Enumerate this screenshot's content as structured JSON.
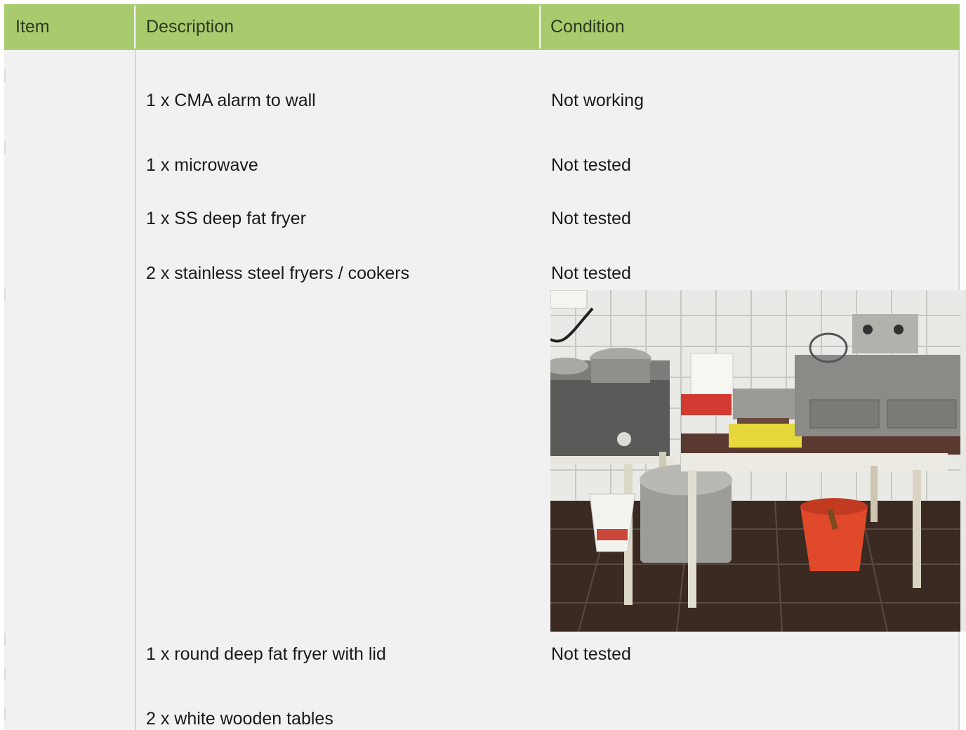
{
  "headers": {
    "item": "Item",
    "description": "Description",
    "condition": "Condition"
  },
  "rows": [
    {
      "description": "1 x CMA alarm to wall",
      "condition": "Not working"
    },
    {
      "description": "1 x microwave",
      "condition": "Not tested"
    },
    {
      "description": "1 x SS deep fat fryer",
      "condition": "Not tested"
    },
    {
      "description": "2 x stainless steel fryers / cookers",
      "condition": "Not tested"
    },
    {
      "description": "1 x round deep fat fryer with lid",
      "condition": "Not tested"
    },
    {
      "description": "2 x white wooden tables",
      "condition": ""
    }
  ],
  "colors": {
    "header_bg": "#a9cb6e",
    "body_bg": "#f1f1f1"
  }
}
